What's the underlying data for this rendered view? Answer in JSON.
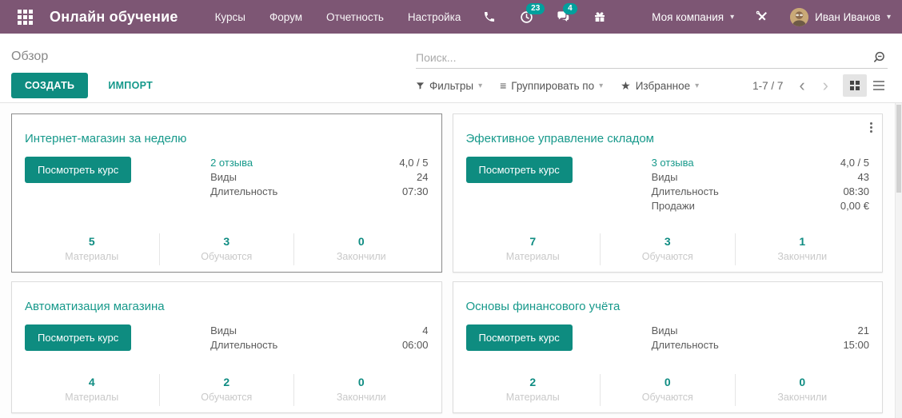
{
  "colors": {
    "navbar_bg": "#7d5674",
    "accent": "#0e8c80",
    "link_teal": "#17998b",
    "badge_teal": "#00a09d"
  },
  "icons": {
    "caret": "▾",
    "star": "★",
    "groupby": "≡",
    "chevron_left": "‹",
    "chevron_right": "›"
  },
  "header": {
    "app_title": "Онлайн обучение",
    "menu": [
      {
        "label": "Курсы"
      },
      {
        "label": "Форум"
      },
      {
        "label": "Отчетность"
      },
      {
        "label": "Настройка"
      }
    ],
    "activities_badge": "23",
    "messages_badge": "4",
    "company": "Моя компания",
    "user": "Иван Иванов"
  },
  "control_panel": {
    "breadcrumb": "Обзор",
    "search_placeholder": "Поиск...",
    "create_label": "СОЗДАТЬ",
    "import_label": "ИМПОРТ",
    "filters_label": "Фильтры",
    "groupby_label": "Группировать по",
    "favorites_label": "Избранное",
    "pager": "1-7 / 7"
  },
  "cards": [
    {
      "title": "Интернет-магазин за неделю",
      "button": "Посмотреть курс",
      "rows": [
        {
          "label": "2 отзыва",
          "value": "4,0 / 5"
        },
        {
          "label": "Виды",
          "value": "24"
        },
        {
          "label": "Длительность",
          "value": "07:30"
        }
      ],
      "stats": [
        {
          "value": "5",
          "label": "Материалы"
        },
        {
          "value": "3",
          "label": "Обучаются"
        },
        {
          "value": "0",
          "label": "Закончили"
        }
      ]
    },
    {
      "title": "Эфективное управление складом",
      "button": "Посмотреть курс",
      "rows": [
        {
          "label": "3 отзыва",
          "value": "4,0 / 5"
        },
        {
          "label": "Виды",
          "value": "43"
        },
        {
          "label": "Длительность",
          "value": "08:30"
        },
        {
          "label": "Продажи",
          "value": "0,00 €"
        }
      ],
      "stats": [
        {
          "value": "7",
          "label": "Материалы"
        },
        {
          "value": "3",
          "label": "Обучаются"
        },
        {
          "value": "1",
          "label": "Закончили"
        }
      ]
    },
    {
      "title": "Автоматизация магазина",
      "button": "Посмотреть курс",
      "rows": [
        {
          "label": "Виды",
          "value": "4"
        },
        {
          "label": "Длительность",
          "value": "06:00"
        }
      ],
      "stats": [
        {
          "value": "4",
          "label": "Материалы"
        },
        {
          "value": "2",
          "label": "Обучаются"
        },
        {
          "value": "0",
          "label": "Закончили"
        }
      ]
    },
    {
      "title": "Основы финансового учёта",
      "button": "Посмотреть курс",
      "rows": [
        {
          "label": "Виды",
          "value": "21"
        },
        {
          "label": "Длительность",
          "value": "15:00"
        }
      ],
      "stats": [
        {
          "value": "2",
          "label": "Материалы"
        },
        {
          "value": "0",
          "label": "Обучаются"
        },
        {
          "value": "0",
          "label": "Закончили"
        }
      ]
    }
  ]
}
